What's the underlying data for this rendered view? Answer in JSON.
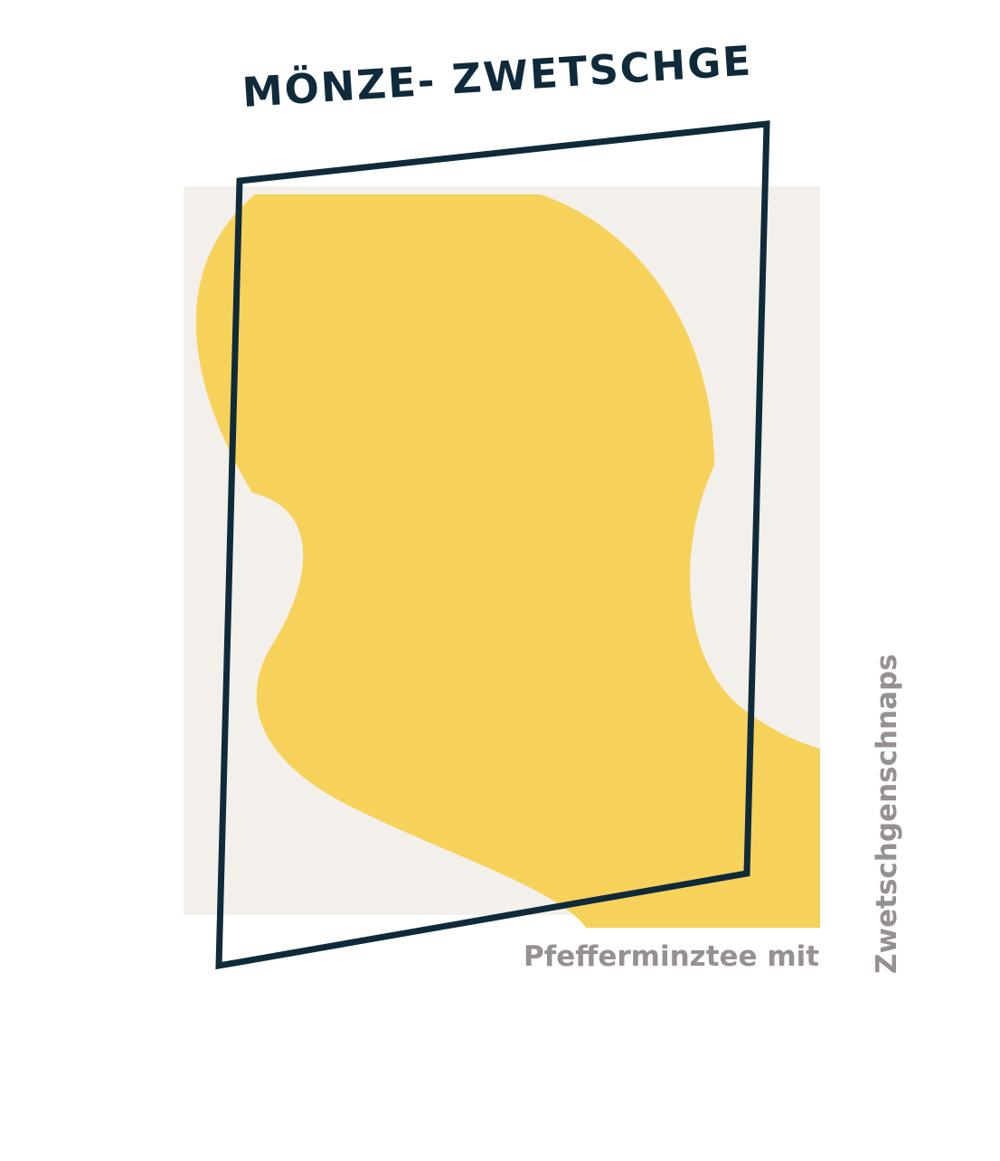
{
  "title": "MÖNZE- ZWETSCHGE",
  "subtitle_line1": "Pfefferminztee mit",
  "subtitle_line2": "Zwetschgenschnaps",
  "colors": {
    "background": "#ffffff",
    "panel": "#f3f0ec",
    "blob": "#f7d25a",
    "frame": "#0f2a3a",
    "subtitle": "#969090"
  }
}
